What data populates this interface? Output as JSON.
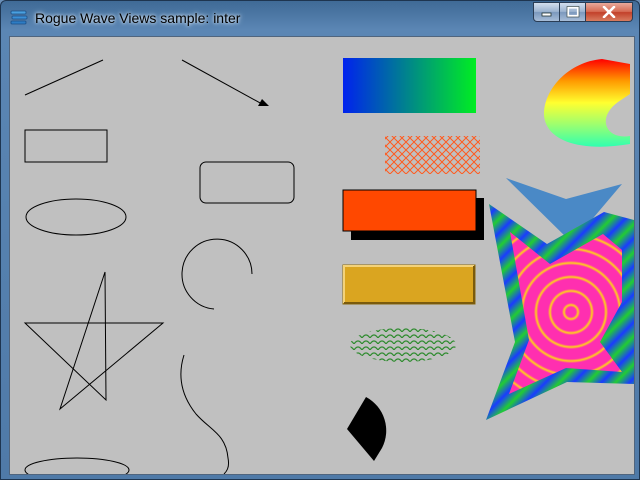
{
  "window": {
    "title": "Rogue Wave Views sample: inter",
    "app_icon": "stacked-layers-icon",
    "controls": {
      "minimize_icon": "minimize-icon",
      "maximize_icon": "maximize-icon",
      "close_icon": "close-icon"
    }
  },
  "canvas": {
    "background": "#c0c0c0",
    "colors": {
      "gradient_rect_start": "#0022ee",
      "gradient_rect_end": "#00ee22",
      "hatch_rect": "#ff5a1e",
      "shadow_rect_fill": "#ff4800",
      "relief_rect_fill": "#daa520",
      "hatch_ellipse": "#2e8b2e",
      "polygon_blue": "#4a89c6",
      "star_ring_pink": "#ff2fb0",
      "star_ring_yellow": "#ffd21a"
    },
    "shapes": [
      "line",
      "arrow-line",
      "rectangle",
      "rounded-rectangle",
      "ellipse",
      "arc",
      "polyline-star",
      "spline",
      "gradient-rectangle",
      "hatched-rectangle",
      "shadow-rectangle",
      "relief-rectangle",
      "hatched-ellipse",
      "filled-arc",
      "gradient-pie",
      "gradient-star",
      "polygon"
    ]
  }
}
